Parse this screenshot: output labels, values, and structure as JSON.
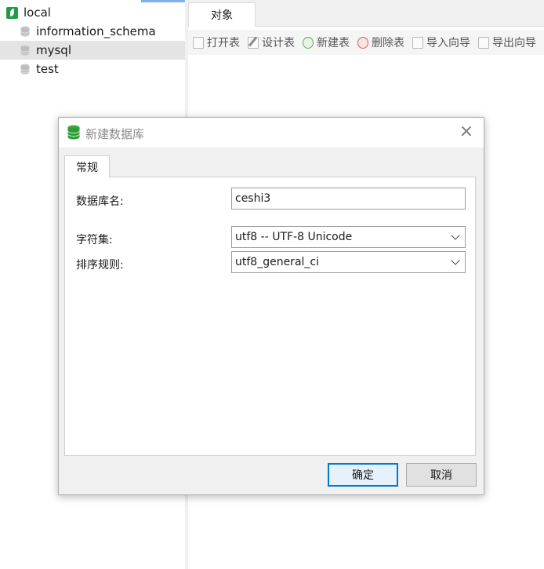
{
  "navigator": {
    "connection": "local",
    "databases": [
      {
        "label": "information_schema",
        "selected": false
      },
      {
        "label": "mysql",
        "selected": true
      },
      {
        "label": "test",
        "selected": false
      }
    ]
  },
  "tabs": {
    "objects": "对象"
  },
  "toolbar": {
    "open_table": "打开表",
    "design_table": "设计表",
    "new_table": "新建表",
    "delete_table": "删除表",
    "import_wizard": "导入向导",
    "export_wizard": "导出向导"
  },
  "dialog": {
    "title": "新建数据库",
    "close_glyph": "×",
    "tab_general": "常规",
    "fields": {
      "db_name_label": "数据库名:",
      "db_name_value": "ceshi3",
      "charset_label": "字符集:",
      "charset_value": "utf8 -- UTF-8 Unicode",
      "collation_label": "排序规则:",
      "collation_value": "utf8_general_ci"
    },
    "ok_button": "确定",
    "cancel_button": "取消"
  },
  "colors": {
    "connection_icon": "#1e9c48",
    "selection_bg": "#e4e4e4",
    "default_button_border": "#0078d7"
  },
  "icons": {
    "connection": "mysql-connection-icon",
    "database": "database-icon",
    "dialog": "database-icon",
    "close": "close-icon"
  }
}
